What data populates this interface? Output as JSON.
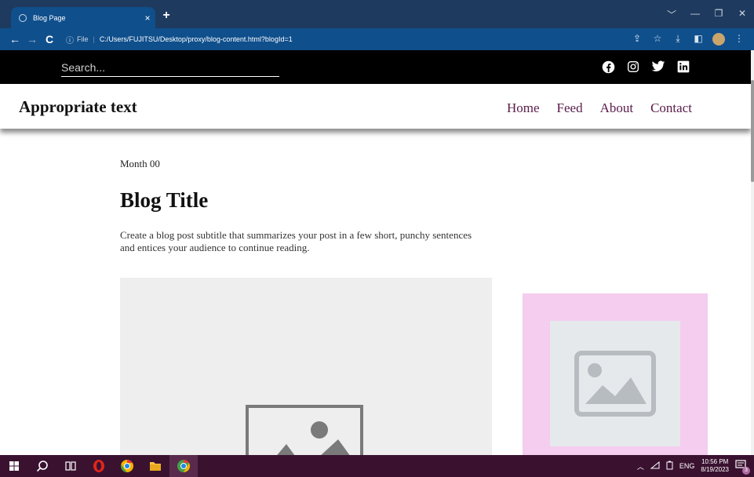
{
  "browser": {
    "tab_title": "Blog Page",
    "tab_close": "×",
    "new_tab": "+",
    "window_controls": [
      "﹀",
      "—",
      "❐",
      "✕"
    ],
    "url_scheme_label": "File",
    "url": "C:/Users/FUJITSU/Desktop/proxy/blog-content.html?blogId=1"
  },
  "page": {
    "search_placeholder": "Search...",
    "social_icons": [
      "facebook-icon",
      "instagram-icon",
      "twitter-icon",
      "linkedin-icon"
    ],
    "brand": "Appropriate text",
    "nav": [
      "Home",
      "Feed",
      "About",
      "Contact"
    ],
    "date": "Month 00",
    "title": "Blog Title",
    "subtitle": "Create a blog post subtitle that summarizes your post in a few short, punchy sentences and entices your audience to continue reading."
  },
  "taskbar": {
    "lang": "ENG",
    "time": "10:56 PM",
    "date": "8/19/2023",
    "notification_count": "3"
  },
  "colors": {
    "titlebar": "#1e3a5f",
    "addressbar": "#0f4f8c",
    "nav_link": "#5a1b4a",
    "side_panel": "#f4cdef",
    "taskbar": "#3a1230"
  }
}
